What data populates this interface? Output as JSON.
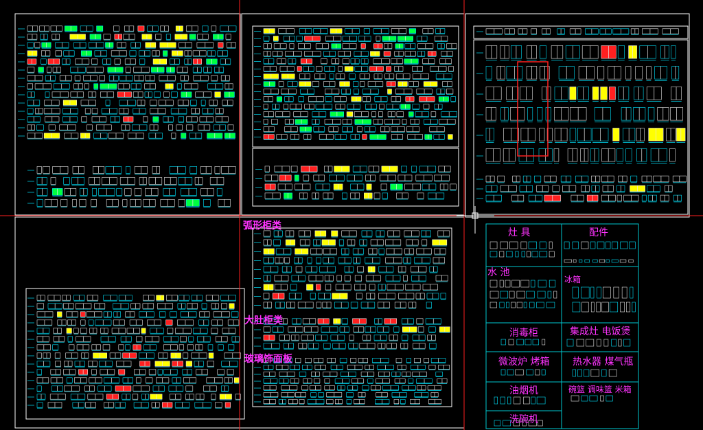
{
  "viewport": {
    "background": "#000000"
  },
  "colors": {
    "frame": "#ffffff",
    "crosshair": "#ff2020",
    "block_cyan": "#00e5ff",
    "block_white": "#e8e8e8",
    "accent_yellow": "#ffff00",
    "accent_red": "#ff2020",
    "accent_green": "#00ff40",
    "legend_text": "#ff33ff",
    "legend_grid": "#00c8d0",
    "label_magenta": "#ff33ff"
  },
  "section_labels": [
    {
      "key": "arc",
      "text": "弧形柜类"
    },
    {
      "key": "corner",
      "text": "大肚柜类"
    },
    {
      "key": "glass",
      "text": "玻璃饰面板"
    }
  ],
  "legend": {
    "cells": [
      {
        "key": "stove",
        "text": "灶  具"
      },
      {
        "key": "parts",
        "text": "配件"
      },
      {
        "key": "sink",
        "text": "水  池"
      },
      {
        "key": "fridge",
        "text": "冰箱"
      },
      {
        "key": "sterilizer",
        "text": "消毒柜"
      },
      {
        "key": "integrated",
        "text": "集成灶  电饭煲"
      },
      {
        "key": "microwave",
        "text": "微波炉  烤箱"
      },
      {
        "key": "heater",
        "text": "热水器  煤气瓶"
      },
      {
        "key": "hood",
        "text": "油烟机"
      },
      {
        "key": "basket",
        "text": "碗篮  调味篮  米箱"
      },
      {
        "key": "dishwasher",
        "text": "洗碗机"
      }
    ]
  }
}
